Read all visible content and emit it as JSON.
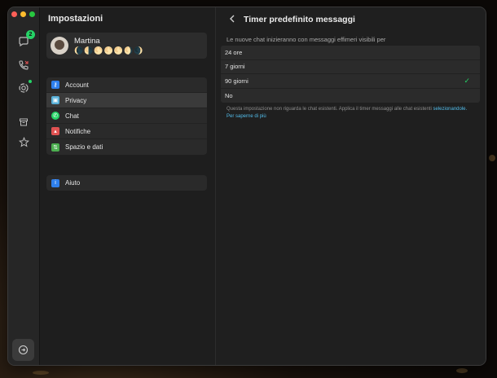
{
  "colors": {
    "accent": "#25d366",
    "link": "#53bdeb"
  },
  "rail": {
    "chats_icon": "chat-bubble-icon",
    "chats_badge": "2",
    "calls_icon": "phone-missed-icon",
    "status_icon": "status-ring-icon",
    "archived_icon": "archive-box-icon",
    "starred_icon": "star-icon",
    "bottom_icon": "settings-circle-icon"
  },
  "settings": {
    "title": "Impostazioni",
    "profile": {
      "name": "Martina",
      "status": "🌘🌗🌕🌕🌕🌖🌒"
    },
    "menu": [
      {
        "label": "Account",
        "icon": "key-icon",
        "color": "#2f80ed"
      },
      {
        "label": "Privacy",
        "icon": "lock-icon",
        "color": "#58b0d8"
      },
      {
        "label": "Chat",
        "icon": "chat-icon",
        "color": "#25d366"
      },
      {
        "label": "Notifiche",
        "icon": "bell-icon",
        "color": "#e05252"
      },
      {
        "label": "Spazio e dati",
        "icon": "storage-icon",
        "color": "#4caf50"
      }
    ],
    "help": {
      "label": "Aiuto",
      "icon": "info-icon",
      "color": "#2f80ed"
    }
  },
  "detail": {
    "title": "Timer predefinito messaggi",
    "intro": "Le nuove chat inizieranno con messaggi effimeri visibili per",
    "options": [
      "24 ore",
      "7 giorni",
      "90 giorni",
      "No"
    ],
    "selected_index": 2,
    "footnote_main": "Questa impostazione non riguarda le chat esistenti. Applica il timer messaggi alle chat esistenti",
    "footnote_link1": "selezionandole.",
    "footnote_link2": "Per saperne di più"
  }
}
